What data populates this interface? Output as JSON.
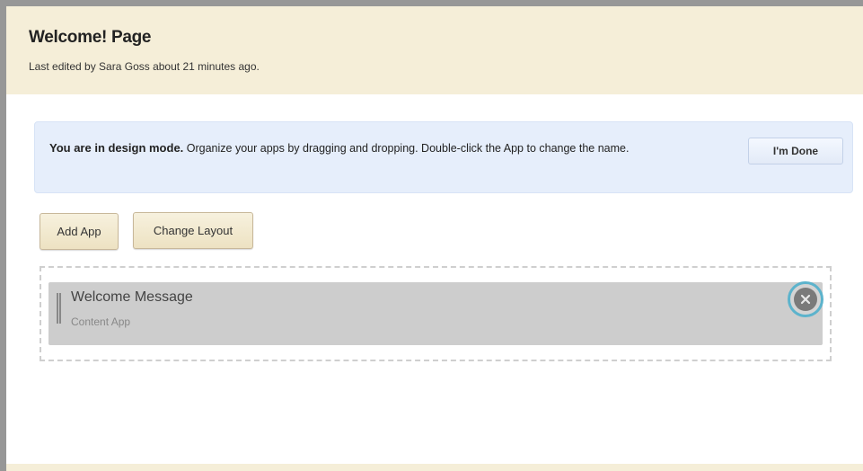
{
  "header": {
    "title": "Welcome! Page",
    "subtitle": "Last edited by Sara Goss about 21 minutes ago."
  },
  "design_mode": {
    "heading": "You are in design mode.",
    "message": " Organize your apps by dragging and dropping. Double-click the App to change the name.",
    "done_label": "I'm Done"
  },
  "toolbar": {
    "add_app_label": "Add App",
    "change_layout_label": "Change Layout"
  },
  "apps": [
    {
      "name": "Welcome Message",
      "type": "Content App"
    }
  ],
  "colors": {
    "header_background": "#f5eed8",
    "banner_background": "#e6eefb",
    "tile_background": "#cdcdcd",
    "remove_focus_ring": "#5cb3cc"
  },
  "icons": {
    "remove": "close-circle-icon",
    "drag": "drag-handle-icon"
  }
}
